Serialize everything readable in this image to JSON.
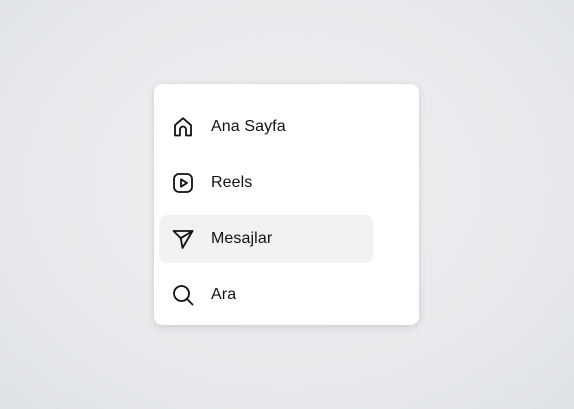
{
  "menu": {
    "items": [
      {
        "label": "Ana Sayfa",
        "icon": "home-icon",
        "active": false
      },
      {
        "label": "Reels",
        "icon": "reels-icon",
        "active": false
      },
      {
        "label": "Mesajlar",
        "icon": "send-icon",
        "active": true
      },
      {
        "label": "Ara",
        "icon": "search-icon",
        "active": false
      }
    ],
    "colors": {
      "card_background": "#ffffff",
      "active_background": "#f2f2f2",
      "text": "#111111",
      "icon_stroke": "#111111"
    }
  }
}
